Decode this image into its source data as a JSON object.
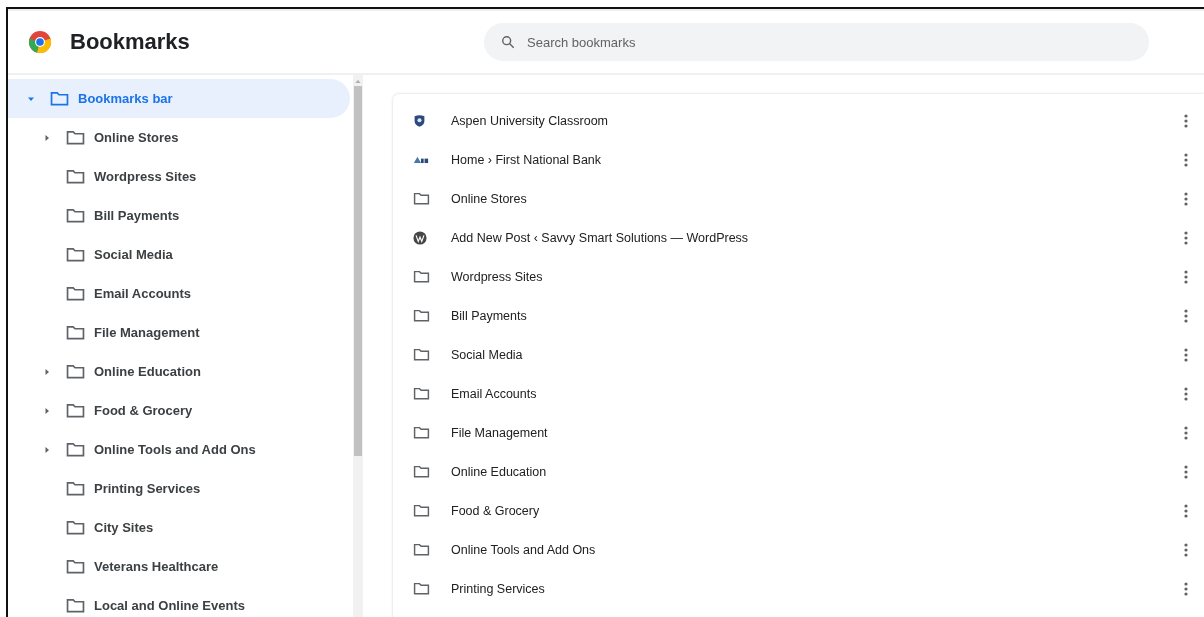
{
  "header": {
    "title": "Bookmarks"
  },
  "search": {
    "placeholder": "Search bookmarks"
  },
  "sidebar": {
    "tree": [
      {
        "label": "Bookmarks bar",
        "selected": true,
        "expanded": true,
        "children": [
          {
            "label": "Online Stores",
            "selected": false,
            "collapsed": true
          },
          {
            "label": "Wordpress Sites",
            "selected": false,
            "collapsed": false
          },
          {
            "label": "Bill Payments",
            "selected": false,
            "collapsed": false
          },
          {
            "label": "Social Media",
            "selected": false,
            "collapsed": false
          },
          {
            "label": "Email Accounts",
            "selected": false,
            "collapsed": false
          },
          {
            "label": "File Management",
            "selected": false,
            "collapsed": false
          },
          {
            "label": "Online Education",
            "selected": false,
            "collapsed": true
          },
          {
            "label": "Food & Grocery",
            "selected": false,
            "collapsed": true
          },
          {
            "label": "Online Tools and Add Ons",
            "selected": false,
            "collapsed": true
          },
          {
            "label": "Printing Services",
            "selected": false,
            "collapsed": false
          },
          {
            "label": "City Sites",
            "selected": false,
            "collapsed": false
          },
          {
            "label": "Veterans Healthcare",
            "selected": false,
            "collapsed": false
          },
          {
            "label": "Local and Online Events",
            "selected": false,
            "collapsed": false
          }
        ]
      }
    ]
  },
  "list": {
    "items": [
      {
        "kind": "shield",
        "title": "Aspen University Classroom"
      },
      {
        "kind": "bank",
        "title": "Home › First National Bank"
      },
      {
        "kind": "folder",
        "title": "Online Stores"
      },
      {
        "kind": "wordpress",
        "title": "Add New Post ‹ Savvy Smart Solutions — WordPress"
      },
      {
        "kind": "folder",
        "title": "Wordpress Sites"
      },
      {
        "kind": "folder",
        "title": "Bill Payments"
      },
      {
        "kind": "folder",
        "title": "Social Media"
      },
      {
        "kind": "folder",
        "title": "Email Accounts"
      },
      {
        "kind": "folder",
        "title": "File Management"
      },
      {
        "kind": "folder",
        "title": "Online Education"
      },
      {
        "kind": "folder",
        "title": "Food & Grocery"
      },
      {
        "kind": "folder",
        "title": "Online Tools and Add Ons"
      },
      {
        "kind": "folder",
        "title": "Printing Services"
      }
    ]
  }
}
